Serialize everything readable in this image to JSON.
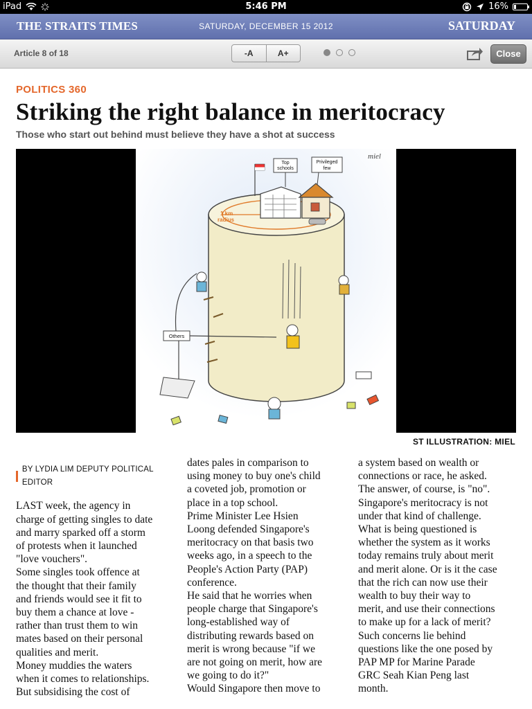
{
  "status_bar": {
    "device": "iPad",
    "time": "5:46 PM",
    "battery": "16%",
    "battery_level": 0.16
  },
  "masthead": {
    "paper": "THE STRAITS TIMES",
    "date": "SATURDAY, DECEMBER 15 2012",
    "day": "SATURDAY"
  },
  "toolbar": {
    "article_count": "Article 8 of 18",
    "font_decrease": "-A",
    "font_increase": "A+",
    "close": "Close",
    "page_dots": 3,
    "active_dot": 0
  },
  "article": {
    "kicker": "POLITICS 360",
    "headline": "Striking the right balance in meritocracy",
    "subhead": "Those who start out behind must believe they have a shot at success",
    "illustration": {
      "signature": "miel",
      "label_top_schools": "Top\nschools",
      "label_privileged": "Privileged\nfew",
      "label_radius": "1 km\nradius",
      "label_others": "Others"
    },
    "credit": "ST ILLUSTRATION: MIEL",
    "byline": "BY LYDIA LIM DEPUTY POLITICAL EDITOR",
    "columns": [
      "LAST week, the agency in\ncharge of getting singles to date\nand marry sparked off a storm\nof protests when it launched\n\"love vouchers\".\n Some singles took offence at\nthe thought that their family\nand friends would see it fit to\nbuy them a chance at love -\nrather than trust them to win\nmates based on their personal\nqualities and merit.\n Money muddies the waters\nwhen it comes to relationships.\n But subsidising the cost of",
      "dates pales in comparison to\nusing money to buy one's child\na coveted job, promotion or\nplace in a top school.\n Prime Minister Lee Hsien\nLoong defended Singapore's\nmeritocracy on that basis two\nweeks ago, in a speech to the\nPeople's Action Party (PAP)\nconference.\n He said that he worries when\npeople charge that Singapore's\nlong-established way of\ndistributing rewards based on\nmerit is wrong because \"if we\nare not going on merit, how are\nwe going to do it?\"\n Would Singapore then move to",
      "a system based on wealth or\nconnections or race, he asked.\n The answer, of course, is \"no\".\nSingapore's meritocracy is not\nunder that kind of challenge.\n What is being questioned is\nwhether the system as it works\ntoday remains truly about merit\nand merit alone. Or is it the case\nthat the rich can now use their\nwealth to buy their way to\nmerit, and use their connections\nto make up for a lack of merit?\n Such concerns lie behind\nquestions like the one posed by\nPAP MP for Marine Parade\nGRC Seah Kian Peng last\nmonth."
    ]
  },
  "colors": {
    "masthead": "#6f7fbb",
    "accent": "#e4672b",
    "text": "#111111"
  }
}
